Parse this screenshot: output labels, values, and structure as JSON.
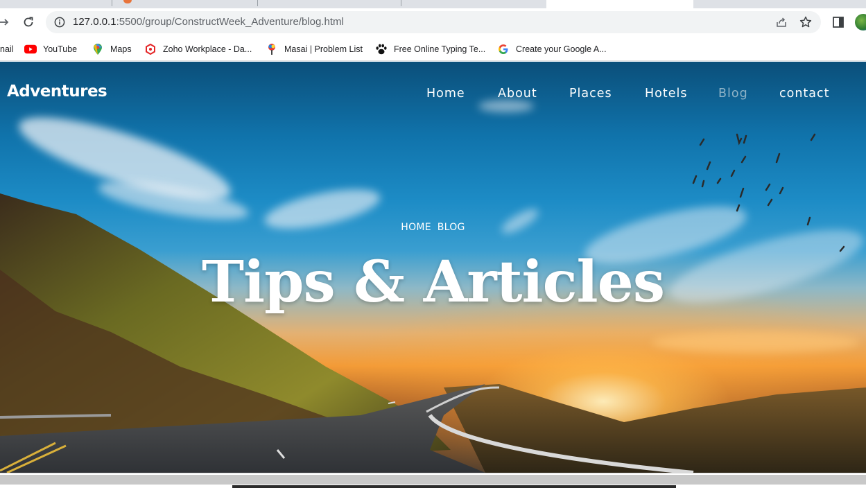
{
  "browser": {
    "url_host": "127.0.0.1",
    "url_path": ":5500/group/ConstructWeek_Adventure/blog.html",
    "bookmarks": [
      {
        "label": "nail",
        "icon": "gmail-icon"
      },
      {
        "label": "YouTube",
        "icon": "youtube-icon",
        "color": "#ff0000"
      },
      {
        "label": "Maps",
        "icon": "maps-icon"
      },
      {
        "label": "Zoho Workplace - Da...",
        "icon": "zoho-icon",
        "color": "#e42527"
      },
      {
        "label": "Masai | Problem List",
        "icon": "masai-icon"
      },
      {
        "label": "Free Online Typing Te...",
        "icon": "paw-icon",
        "color": "#111111"
      },
      {
        "label": "Create your Google A...",
        "icon": "google-icon"
      }
    ]
  },
  "site": {
    "logo": "Adventures",
    "nav": [
      {
        "label": "Home"
      },
      {
        "label": "About"
      },
      {
        "label": "Places"
      },
      {
        "label": "Hotels"
      },
      {
        "label": "Blog",
        "active": true
      },
      {
        "label": "contact"
      }
    ],
    "breadcrumb": [
      "HOME",
      "BLOG"
    ],
    "title": "Tips & Articles",
    "active_nav_color": "#8fb3c7"
  }
}
